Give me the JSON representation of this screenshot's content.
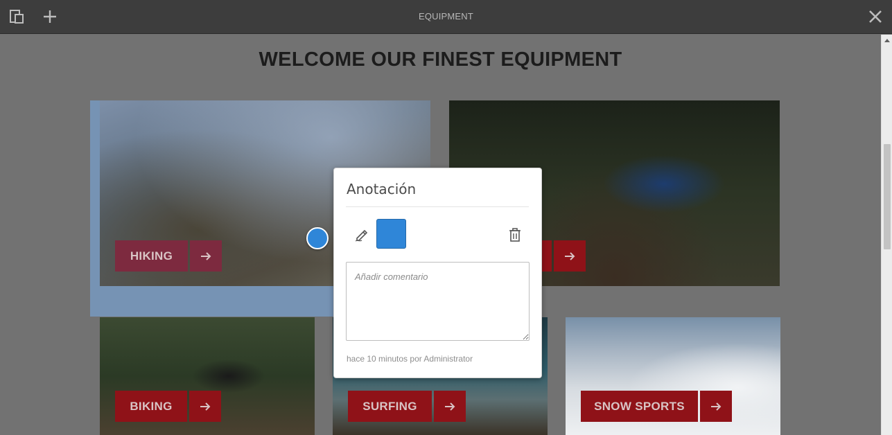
{
  "toolbar": {
    "title": "EQUIPMENT",
    "icons": {
      "left": "page-layout-icon",
      "add": "plus-icon",
      "close": "close-icon"
    }
  },
  "page": {
    "heading": "WELCOME OUR FINEST EQUIPMENT",
    "cards": [
      {
        "label": "HIKING",
        "icon": "arrow-right-icon"
      },
      {
        "label": "",
        "icon": "arrow-right-icon"
      },
      {
        "label": "BIKING",
        "icon": "arrow-right-icon"
      },
      {
        "label": "SURFING",
        "icon": "arrow-right-icon"
      },
      {
        "label": "SNOW SPORTS",
        "icon": "arrow-right-icon"
      }
    ]
  },
  "annotation": {
    "title": "Anotación",
    "color": "#2f86d8",
    "comment_placeholder": "Añadir comentario",
    "meta": "hace 10 minutos por Administrator",
    "icons": {
      "edit": "pen-icon",
      "delete": "trash-icon"
    }
  },
  "colors": {
    "cta_red": "#8f1218",
    "toolbar": "#3d3d3d",
    "selection_blue": "#78a5d7"
  }
}
